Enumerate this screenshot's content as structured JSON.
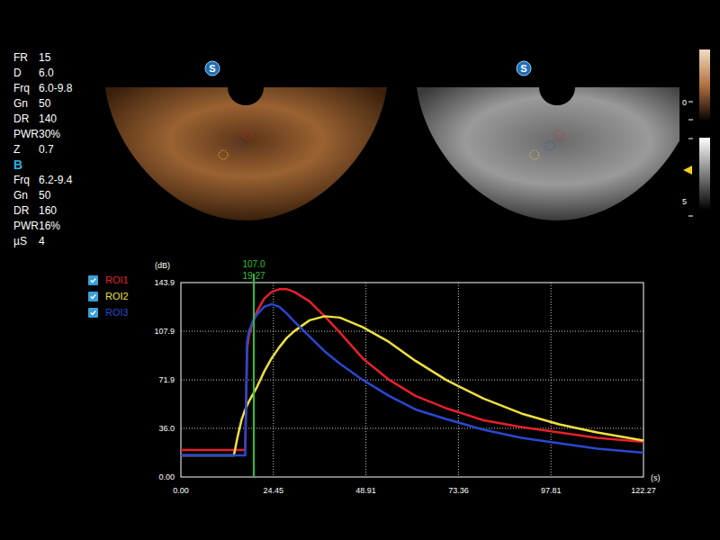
{
  "parameters": {
    "contrast": [
      {
        "label": "FR",
        "value": "15"
      },
      {
        "label": "D",
        "value": "6.0"
      },
      {
        "label": "Frq",
        "value": "6.0-9.8"
      },
      {
        "label": "Gn",
        "value": "50"
      },
      {
        "label": "DR",
        "value": "140"
      },
      {
        "label": "PWR",
        "value": "30%"
      },
      {
        "label": "Z",
        "value": "0.7"
      }
    ],
    "b_mode_title": "B",
    "b_mode": [
      {
        "label": "Frq",
        "value": "6.2-9.4"
      },
      {
        "label": "Gn",
        "value": "50"
      },
      {
        "label": "DR",
        "value": "160"
      },
      {
        "label": "PWR",
        "value": "16%"
      },
      {
        "label": "µS",
        "value": "4"
      }
    ]
  },
  "images": [
    {
      "name": "contrast",
      "logo": "S"
    },
    {
      "name": "b-mode",
      "logo": "S"
    }
  ],
  "color_bars": [
    {
      "name": "contrast-map",
      "tick": "0"
    },
    {
      "name": "gray-map",
      "tick": "5"
    }
  ],
  "chart": {
    "y_unit": "(dB)",
    "x_unit": "(s)",
    "y_max": 143.9,
    "x_max": 122.27,
    "y_ticks": [
      "143.9",
      "107.9",
      "71.9",
      "36.0",
      "0.00"
    ],
    "x_ticks": [
      "0.00",
      "24.45",
      "48.91",
      "73.36",
      "97.81",
      "122.27"
    ],
    "cursor": {
      "time": 19.27,
      "value_label": "107.0",
      "time_label": "19.27"
    },
    "times": [
      0,
      14,
      15,
      16,
      17,
      17.5,
      18,
      19,
      20,
      22,
      24,
      26,
      28,
      30,
      34,
      38,
      42,
      48,
      55,
      62,
      70,
      80,
      90,
      100,
      110,
      122.27
    ],
    "series": [
      {
        "name": "ROI1",
        "checked": true,
        "color": "#e8202a",
        "values": [
          20,
          20,
          20,
          20,
          20,
          95,
          105,
          115,
          122,
          132,
          137,
          139,
          139,
          137,
          130,
          119,
          107,
          88,
          72,
          60,
          51,
          42,
          37,
          33,
          29,
          26
        ]
      },
      {
        "name": "ROI2",
        "checked": true,
        "color": "#f0e040",
        "values": [
          16,
          16,
          30,
          42,
          50,
          53,
          56,
          61,
          66,
          78,
          88,
          96,
          103,
          108,
          116,
          119,
          118,
          111,
          100,
          86,
          72,
          58,
          47,
          39,
          33,
          27
        ]
      },
      {
        "name": "ROI3",
        "checked": true,
        "color": "#2a48d0",
        "values": [
          16,
          16,
          16,
          16,
          16,
          100,
          108,
          115,
          120,
          126,
          128,
          126,
          121,
          115,
          104,
          93,
          84,
          72,
          60,
          50,
          43,
          35,
          29,
          25,
          21,
          18
        ]
      }
    ]
  }
}
